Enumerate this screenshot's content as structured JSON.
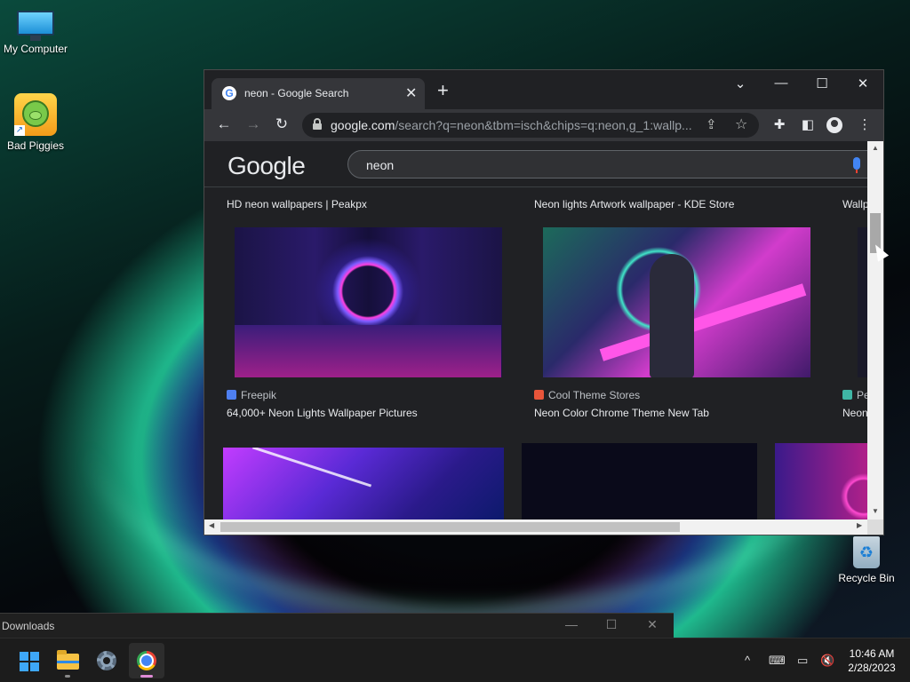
{
  "desktop": {
    "icons": [
      {
        "label": "My Computer",
        "icon": "monitor-icon"
      },
      {
        "label": "Bad Piggies",
        "icon": "bad-piggies-icon"
      },
      {
        "label": "Recycle Bin",
        "icon": "recycle-bin-icon"
      }
    ]
  },
  "browser": {
    "tab": {
      "title": "neon - Google Search",
      "close": "✕"
    },
    "new_tab": "+",
    "window_controls": {
      "dropdown": "⌄",
      "minimize": "—",
      "maximize": "☐",
      "close": "✕"
    },
    "url": {
      "host": "google.com",
      "path": "/search?q=neon&tbm=isch&chips=q:neon,g_1:wallp..."
    },
    "nav": {
      "back": "←",
      "forward": "→",
      "reload": "↻"
    }
  },
  "google": {
    "logo": "Google",
    "query": "neon",
    "results_row1": [
      {
        "title": "HD neon wallpapers | Peakpx"
      },
      {
        "title": "Neon lights Artwork wallpaper - KDE Store"
      },
      {
        "title": "Wallp"
      }
    ],
    "results_row2": [
      {
        "source": "Freepik",
        "title": "64,000+ Neon Lights Wallpaper Pictures",
        "source_color": "#4e7ff0"
      },
      {
        "source": "Cool Theme Stores",
        "title": "Neon Color Chrome Theme New Tab",
        "source_color": "#e8553a"
      },
      {
        "source": "Pe",
        "title": "Neon",
        "source_color": "#3fb6a5"
      }
    ]
  },
  "downloads": {
    "title": "Downloads"
  },
  "taskbar": {
    "time": "10:46 AM",
    "date": "2/28/2023",
    "tray_chevron": "^"
  },
  "colors": {
    "accent_blue": "#3ea7f7",
    "chrome_dark": "#202124",
    "chrome_toolbar": "#35363a"
  }
}
